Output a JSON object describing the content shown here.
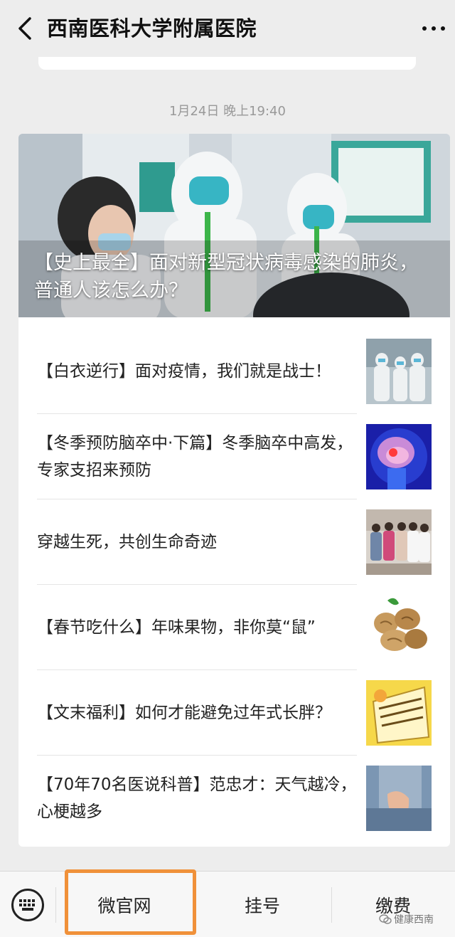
{
  "header": {
    "title": "西南医科大学附属医院",
    "back_icon": "chevron-left-icon",
    "more_icon": "more-dots-icon"
  },
  "timestamp": "1月24日 晚上19:40",
  "hero": {
    "title_line1": "【史上最全】面对新型冠状病毒感染的肺炎，",
    "title_line2": "普通人该怎么办？"
  },
  "articles": [
    {
      "title": "【白衣逆行】面对疫情，我们就是战士！"
    },
    {
      "title": "【冬季预防脑卒中·下篇】冬季脑卒中高发，专家支招来预防"
    },
    {
      "title": "穿越生死，共创生命奇迹"
    },
    {
      "title": "【春节吃什么】年味果物，非你莫“鼠”"
    },
    {
      "title": "【文末福利】如何才能避免过年式长胖？"
    },
    {
      "title": "【70年70名医说科普】范忠才：天气越冷，心梗越多"
    }
  ],
  "bottom_menu": {
    "keyboard_icon": "keyboard-icon",
    "items": [
      {
        "label": "微官网"
      },
      {
        "label": "挂号"
      },
      {
        "label": "缴费"
      }
    ]
  },
  "watermark": "健康西南",
  "colors": {
    "highlight": "#f0913a",
    "background": "#ededed"
  }
}
